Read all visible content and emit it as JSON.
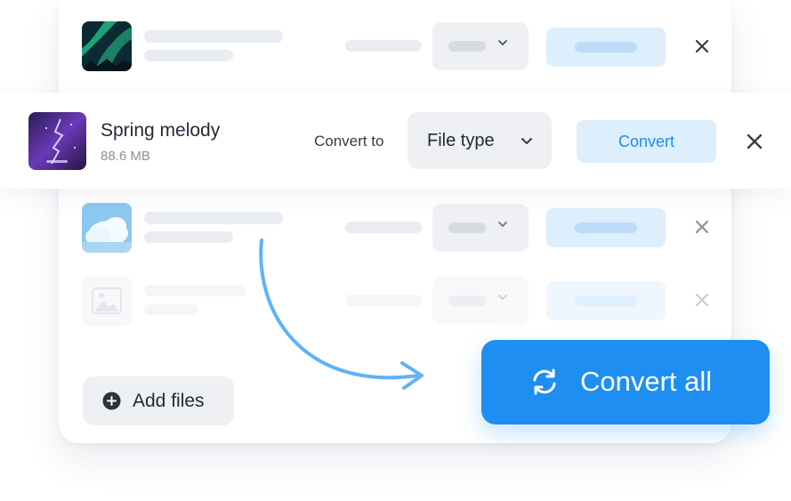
{
  "active_file": {
    "name": "Spring melody",
    "size": "88.6 MB",
    "convert_to_label": "Convert to",
    "file_type_select": "File type",
    "convert_button": "Convert"
  },
  "actions": {
    "add_files": "Add files",
    "convert_all": "Convert all"
  },
  "icons": {
    "close": "close-icon",
    "chevron": "chevron-down-icon",
    "add": "plus-circle-icon",
    "convert_all": "refresh-icon",
    "arrow": "curved-arrow-icon",
    "placeholder_image": "image-placeholder-icon"
  },
  "colors": {
    "accent": "#1e8ef2",
    "accent_light": "#ddeefd",
    "neutral_light": "#eef0f4",
    "text_dark": "#222b36",
    "text_muted": "#8a929c"
  }
}
